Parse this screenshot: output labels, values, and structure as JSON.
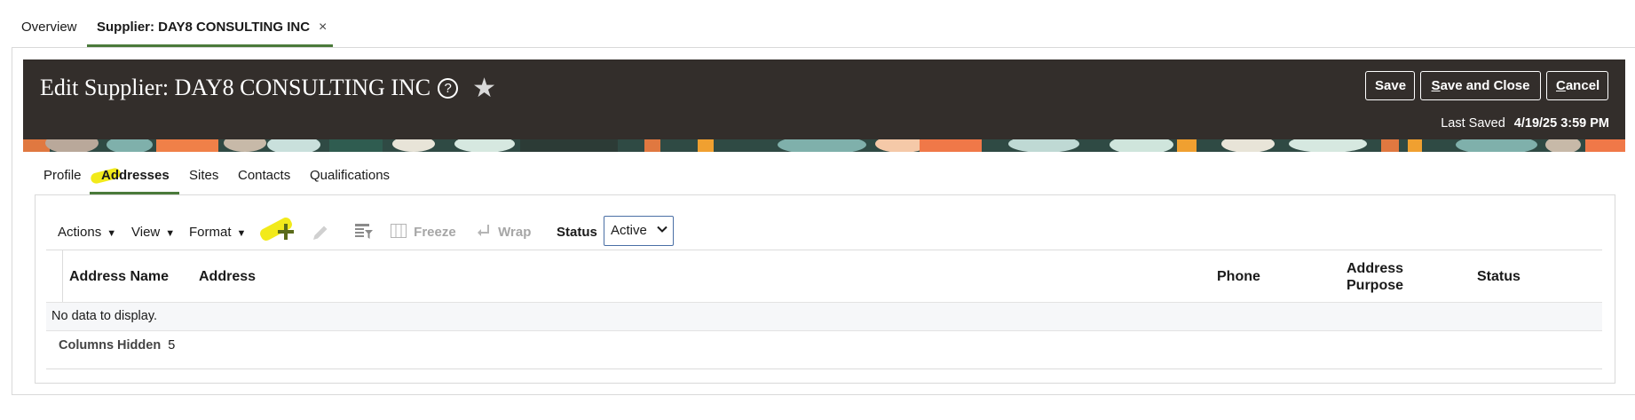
{
  "tabs": {
    "overview": "Overview",
    "supplier": "Supplier: DAY8 CONSULTING INC",
    "close_glyph": "×"
  },
  "header": {
    "title": "Edit Supplier: DAY8 CONSULTING INC",
    "help_glyph": "?",
    "star_glyph": "★",
    "save_label": "Save",
    "save_close_label_first": "S",
    "save_close_label_rest": "ave and Close",
    "cancel_label_first": "C",
    "cancel_label_rest": "ancel",
    "last_saved_label": "Last Saved",
    "last_saved_value": "4/19/25 3:59 PM",
    "background_color": "#332e2b"
  },
  "sub_tabs": [
    "Profile",
    "Addresses",
    "Sites",
    "Contacts",
    "Qualifications"
  ],
  "active_sub_tab": "Addresses",
  "toolbar": {
    "actions_label": "Actions",
    "view_label": "View",
    "format_label": "Format",
    "add_icon": "plus-icon",
    "edit_icon": "pencil-icon",
    "freeze_label": "Freeze",
    "wrap_label": "Wrap",
    "status_label": "Status",
    "status_value": "Active"
  },
  "table": {
    "columns": [
      "Address Name",
      "Address",
      "Phone",
      "Address",
      "Purpose",
      "Status"
    ],
    "empty_text": "No data to display.",
    "columns_hidden_label": "Columns Hidden",
    "columns_hidden_value": "5"
  },
  "colors": {
    "accent_green": "#4a7a3a",
    "highlight_yellow": "#f2ea1a"
  }
}
